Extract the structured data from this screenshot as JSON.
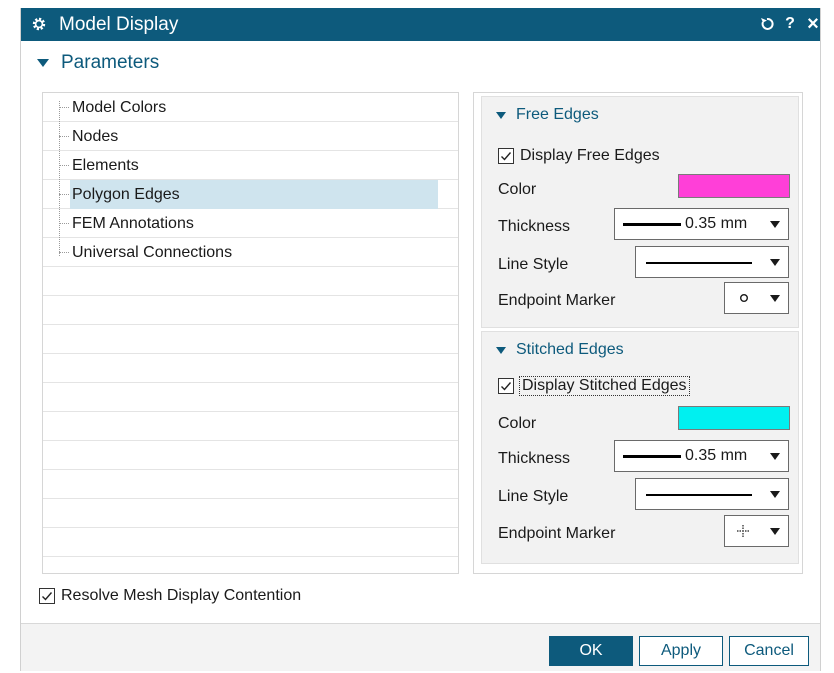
{
  "window": {
    "title": "Model Display",
    "reset_icon": "reset-icon",
    "help_label": "?",
    "close_label": "×"
  },
  "parameters": {
    "label": "Parameters"
  },
  "tree": {
    "items": [
      {
        "label": "Model Colors",
        "selected": false
      },
      {
        "label": "Nodes",
        "selected": false
      },
      {
        "label": "Elements",
        "selected": false
      },
      {
        "label": "Polygon Edges",
        "selected": true
      },
      {
        "label": "FEM Annotations",
        "selected": false
      },
      {
        "label": "Universal Connections",
        "selected": false
      }
    ]
  },
  "free_edges": {
    "header": "Free Edges",
    "display_label": "Display Free Edges",
    "display_checked": true,
    "color_label": "Color",
    "color_value": "#ff3fd8",
    "thickness_label": "Thickness",
    "thickness_value": "0.35 mm",
    "line_style_label": "Line Style",
    "endpoint_label": "Endpoint Marker",
    "endpoint_icon": "circle-marker-icon"
  },
  "stitched_edges": {
    "header": "Stitched Edges",
    "display_label": "Display Stitched Edges",
    "display_checked": true,
    "color_label": "Color",
    "color_value": "#00f0f0",
    "thickness_label": "Thickness",
    "thickness_value": "0.35 mm",
    "line_style_label": "Line Style",
    "endpoint_label": "Endpoint Marker",
    "endpoint_icon": "crosshair-marker-icon"
  },
  "footer": {
    "resolve_label": "Resolve Mesh Display Contention",
    "resolve_checked": true,
    "ok_label": "OK",
    "apply_label": "Apply",
    "cancel_label": "Cancel"
  },
  "colors": {
    "titlebar": "#0d5a7c",
    "accent": "#0d5a7c",
    "selection": "#cfe4ee"
  }
}
